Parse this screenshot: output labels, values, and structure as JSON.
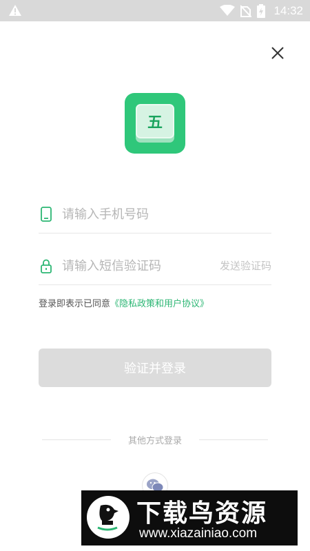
{
  "status_bar": {
    "time": "14:32",
    "icons": [
      "warning-icon",
      "wifi-icon",
      "no-sim-icon",
      "battery-charging-icon"
    ]
  },
  "close": {
    "icon": "close-icon"
  },
  "logo": {
    "glyph": "五",
    "color": "#2fc77a"
  },
  "phone": {
    "placeholder": "请输入手机号码",
    "value": "",
    "icon": "phone-icon"
  },
  "code": {
    "placeholder": "请输入短信验证码",
    "value": "",
    "icon": "lock-icon",
    "send_label": "发送验证码"
  },
  "agreement": {
    "prefix": "登录即表示已同意",
    "link": "《隐私政策和用户协议》",
    "link_color": "#2bb673"
  },
  "login_button": {
    "label": "验证并登录"
  },
  "other_login": {
    "label": "其他方式登录",
    "icon": "wechat-icon"
  },
  "watermark": {
    "title": "下载鸟资源",
    "url": "www.xiazainiao.com"
  }
}
